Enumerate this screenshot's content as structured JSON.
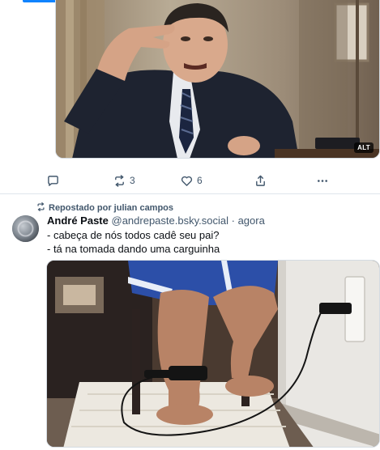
{
  "post1": {
    "alt_badge": "ALT",
    "actions": {
      "reply_count": "",
      "repost_count": "3",
      "like_count": "6"
    }
  },
  "post2": {
    "repost_label": "Repostado por julian campos",
    "author_name": "André Paste",
    "author_handle": "@andrepaste.bsky.social",
    "separator": "·",
    "timestamp": "agora",
    "text_lines": [
      "- cabeça de nós todos cadê seu pai?",
      "- tá na tomada dando uma carguinha"
    ]
  },
  "icons": {
    "reply": "reply-icon",
    "repost": "repost-icon",
    "like": "heart-icon",
    "share": "share-icon",
    "more": "more-icon"
  },
  "colors": {
    "accent": "#1083fe",
    "muted": "#42576c",
    "divider": "#dfe5ec"
  }
}
